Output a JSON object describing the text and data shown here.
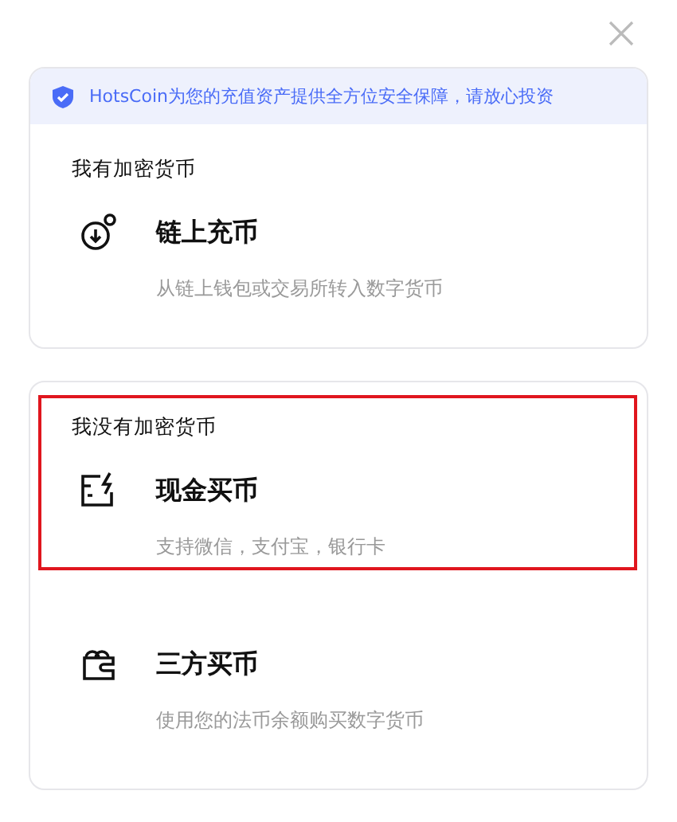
{
  "notice": "HotsCoin为您的充值资产提供全方位安全保障，请放心投资",
  "sections": [
    {
      "heading": "我有加密货币",
      "options": [
        {
          "kind": "deposit",
          "title": "链上充币",
          "subtitle": "从链上钱包或交易所转入数字货币",
          "selected": false
        }
      ]
    },
    {
      "heading": "我没有加密货币",
      "options": [
        {
          "kind": "cash",
          "title": "现金买币",
          "subtitle": "支持微信，支付宝，银行卡",
          "selected": true
        },
        {
          "kind": "wallet",
          "title": "三方买币",
          "subtitle": "使用您的法币余额购买数字货币",
          "selected": false
        }
      ]
    }
  ]
}
